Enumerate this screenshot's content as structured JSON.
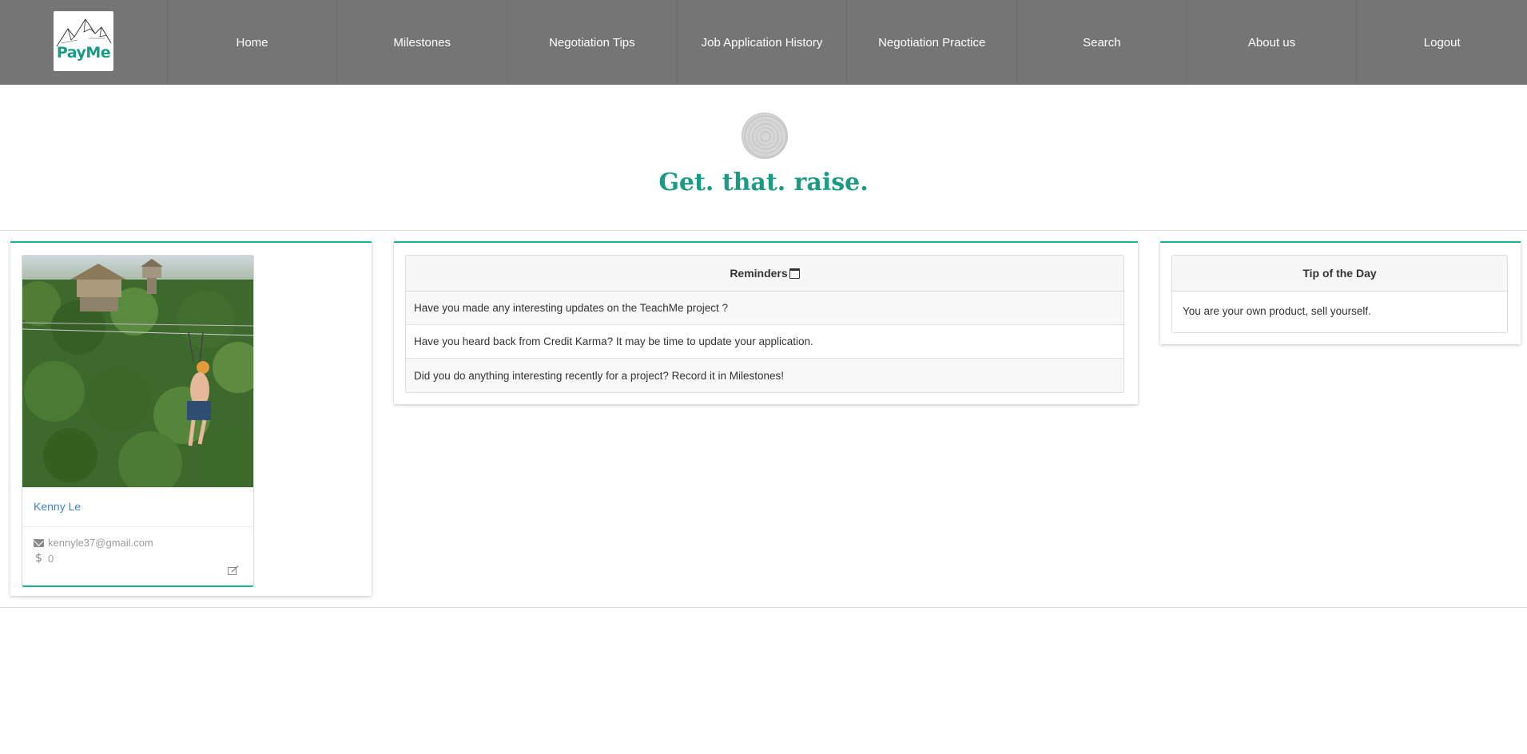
{
  "nav": {
    "logo_text": "PayMe",
    "items": [
      {
        "label": "Home"
      },
      {
        "label": "Milestones"
      },
      {
        "label": "Negotiation Tips"
      },
      {
        "label": "Job Application History"
      },
      {
        "label": "Negotiation Practice"
      },
      {
        "label": "Search"
      },
      {
        "label": "About us"
      },
      {
        "label": "Logout"
      }
    ]
  },
  "hero": {
    "title": "Get. that. raise."
  },
  "profile": {
    "name": "Kenny Le",
    "email": "kennyle37@gmail.com",
    "money": "0",
    "icons": [
      "envelope-icon",
      "dollar-icon",
      "edit-icon"
    ]
  },
  "reminders": {
    "header": "Reminders",
    "header_icon": "calendar-icon",
    "items": [
      {
        "text": "Have you made any interesting updates on the TeachMe project ?"
      },
      {
        "text": "Have you heard back from Credit Karma? It may be time to update your application."
      },
      {
        "text": "Did you do anything interesting recently for a project? Record it in Milestones!"
      }
    ]
  },
  "tip": {
    "header": "Tip of the Day",
    "text": "You are your own product, sell yourself."
  },
  "colors": {
    "nav_bg": "#757575",
    "accent": "#1a9b84",
    "link": "#4183c4"
  }
}
